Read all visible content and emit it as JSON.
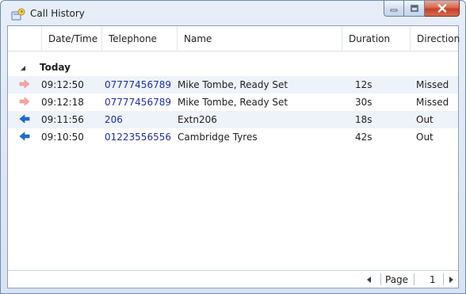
{
  "window": {
    "title": "Call History",
    "controls": {
      "minimize": "minimize",
      "maximize": "maximize",
      "close": "close"
    }
  },
  "columns": [
    "Date/Time",
    "Telephone",
    "Name",
    "Duration",
    "Direction"
  ],
  "group": {
    "label": "Today",
    "expanded": true
  },
  "calls": [
    {
      "time": "09:12:50",
      "telephone": "07777456789",
      "name": "Mike Tombe, Ready Set",
      "duration": "12s",
      "direction": "Missed",
      "icon": "missed-call-arrow-icon"
    },
    {
      "time": "09:12:18",
      "telephone": "07777456789",
      "name": "Mike Tombe, Ready Set",
      "duration": "30s",
      "direction": "Missed",
      "icon": "missed-call-arrow-icon"
    },
    {
      "time": "09:11:56",
      "telephone": "206",
      "name": "Extn206",
      "duration": "18s",
      "direction": "Out",
      "icon": "outgoing-call-arrow-icon"
    },
    {
      "time": "09:10:50",
      "telephone": "01223556556",
      "name": "Cambridge Tyres",
      "duration": "42s",
      "direction": "Out",
      "icon": "outgoing-call-arrow-icon"
    }
  ],
  "pager": {
    "label": "Page",
    "current": "1"
  },
  "colors": {
    "missed_arrow": "#f3a7a5",
    "outgoing_arrow": "#1f6fd6",
    "telephone_link": "#1f2f9c",
    "alt_row": "#eef3fa"
  }
}
